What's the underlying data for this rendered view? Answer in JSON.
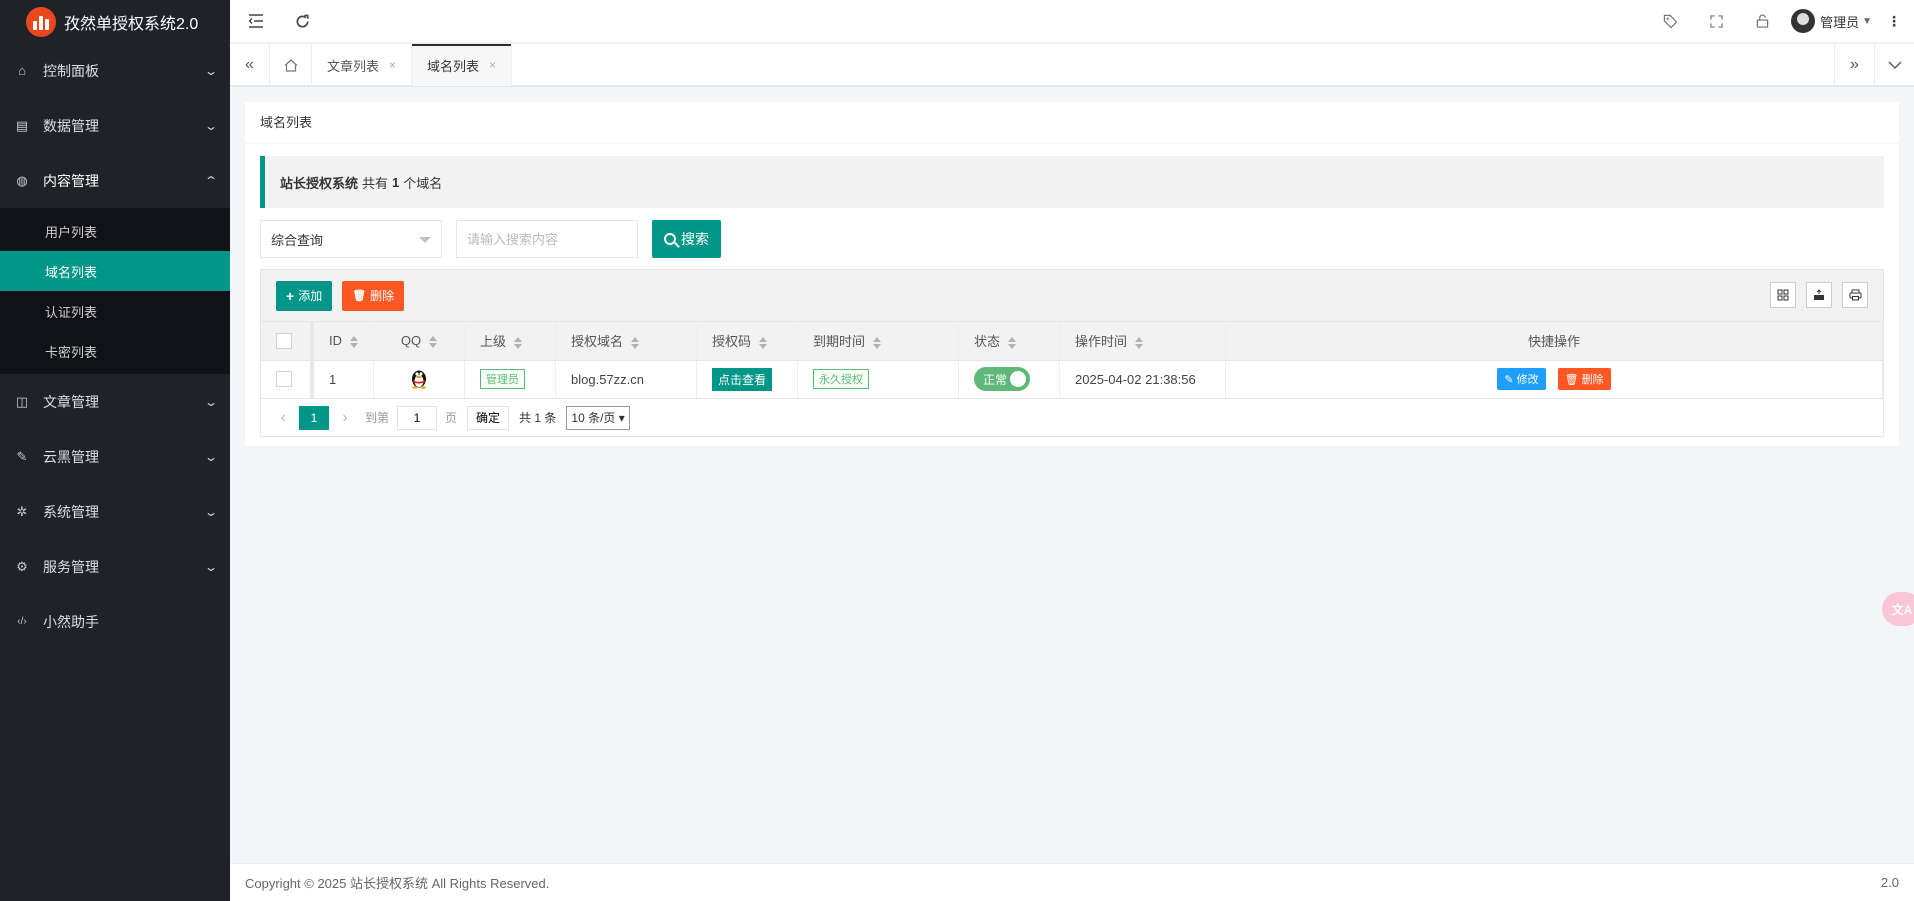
{
  "app": {
    "title": "孜然单授权系统2.0"
  },
  "sidebar": {
    "items": [
      {
        "label": "控制面板",
        "icon": "home-icon",
        "glyph": "⌂",
        "chev": "⌄"
      },
      {
        "label": "数据管理",
        "icon": "file-icon",
        "glyph": "▤",
        "chev": "⌄"
      },
      {
        "label": "内容管理",
        "icon": "globe-icon",
        "glyph": "◍",
        "chev": "⌃"
      },
      {
        "label": "文章管理",
        "icon": "book-icon",
        "glyph": "◫",
        "chev": "⌄"
      },
      {
        "label": "云黑管理",
        "icon": "brush-icon",
        "glyph": "✎",
        "chev": "⌄"
      },
      {
        "label": "系统管理",
        "icon": "gear-icon",
        "glyph": "✲",
        "chev": "⌄"
      },
      {
        "label": "服务管理",
        "icon": "set-icon",
        "glyph": "⚙",
        "chev": "⌄"
      },
      {
        "label": "小然助手",
        "icon": "code-icon",
        "glyph": "‹/›",
        "chev": ""
      }
    ],
    "submenu": [
      "用户列表",
      "域名列表",
      "认证列表",
      "卡密列表"
    ]
  },
  "header": {
    "user": "管理员"
  },
  "tabs": {
    "items": [
      "文章列表",
      "域名列表"
    ],
    "close": "×"
  },
  "card": {
    "title": "域名列表",
    "summary": {
      "site": "站长授权系统",
      "prefix": "共有",
      "count": "1",
      "suffix": "个域名"
    }
  },
  "search": {
    "select_value": "综合查询",
    "placeholder": "请输入搜索内容",
    "button": "搜索"
  },
  "toolbar": {
    "add": "添加",
    "delete": "删除"
  },
  "table": {
    "columns": [
      "ID",
      "QQ",
      "上级",
      "授权域名",
      "授权码",
      "到期时间",
      "状态",
      "操作时间",
      "快捷操作"
    ],
    "rows": [
      {
        "id": "1",
        "parent": "管理员",
        "domain": "blog.57zz.cn",
        "code": "点击查看",
        "expire": "永久授权",
        "status": "正常",
        "time": "2025-04-02 21:38:56",
        "edit": "修改",
        "delete": "删除"
      }
    ]
  },
  "pager": {
    "current": "1",
    "goto": "到第",
    "page_value": "1",
    "page": "页",
    "confirm": "确定",
    "total": "共 1 条",
    "size": "10 条/页"
  },
  "footer": {
    "copyright": "Copyright © 2025 站长授权系统 All Rights Reserved.",
    "version": "2.0"
  },
  "colors": {
    "accent": "#009688",
    "danger": "#ff5722",
    "sidebar": "#20222a",
    "info": "#1e9fff"
  }
}
